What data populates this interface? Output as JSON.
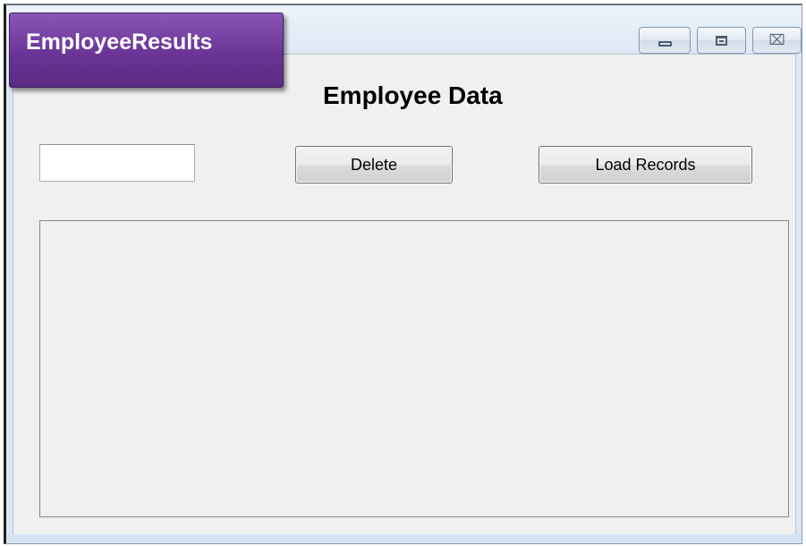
{
  "window": {
    "title": "EmployeeResults"
  },
  "caption_buttons": {
    "minimize_icon": "minimize-icon",
    "maximize_icon": "maximize-icon",
    "close_icon": "close-icon",
    "close_glyph": "⌧"
  },
  "form": {
    "heading": "Employee Data",
    "input": {
      "value": "",
      "placeholder": ""
    },
    "delete_button": "Delete",
    "load_button": "Load Records"
  },
  "colors": {
    "title_badge": "#6a3596",
    "client_background": "#f0f0f0",
    "frame": "#dbe7f3"
  }
}
